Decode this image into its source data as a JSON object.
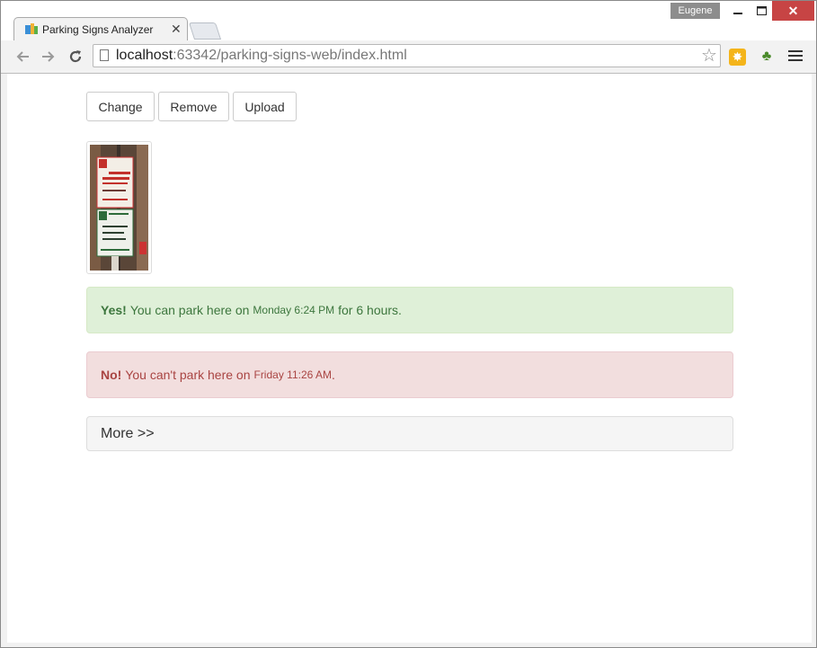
{
  "browser": {
    "tab_title": "Parking Signs Analyzer",
    "tab_close": "✕",
    "user_name": "Eugene",
    "window_controls": {
      "minimize": "—",
      "maximize": "☐",
      "close": "✕"
    },
    "url_host": "localhost",
    "url_rest": ":63342/parking-signs-web/index.html",
    "icons": {
      "back": "back-arrow-icon",
      "forward": "forward-arrow-icon",
      "reload": "reload-icon",
      "bookmark": "star-icon",
      "menu": "hamburger-menu-icon"
    }
  },
  "toolbar": {
    "change_label": "Change",
    "remove_label": "Remove",
    "upload_label": "Upload"
  },
  "results": [
    {
      "status": "success",
      "strong": "Yes!",
      "text": "You can park here on",
      "time": "Monday 6:24 PM",
      "tail": "for 6 hours."
    },
    {
      "status": "danger",
      "strong": "No!",
      "text": "You can't park here on",
      "time": "Friday 11:26 AM",
      "tail": "."
    }
  ],
  "more": {
    "label": "More >>"
  },
  "colors": {
    "success_bg": "#dff0d8",
    "success_text": "#3c763d",
    "danger_bg": "#f2dede",
    "danger_text": "#a94442",
    "close_button": "#c74444"
  }
}
